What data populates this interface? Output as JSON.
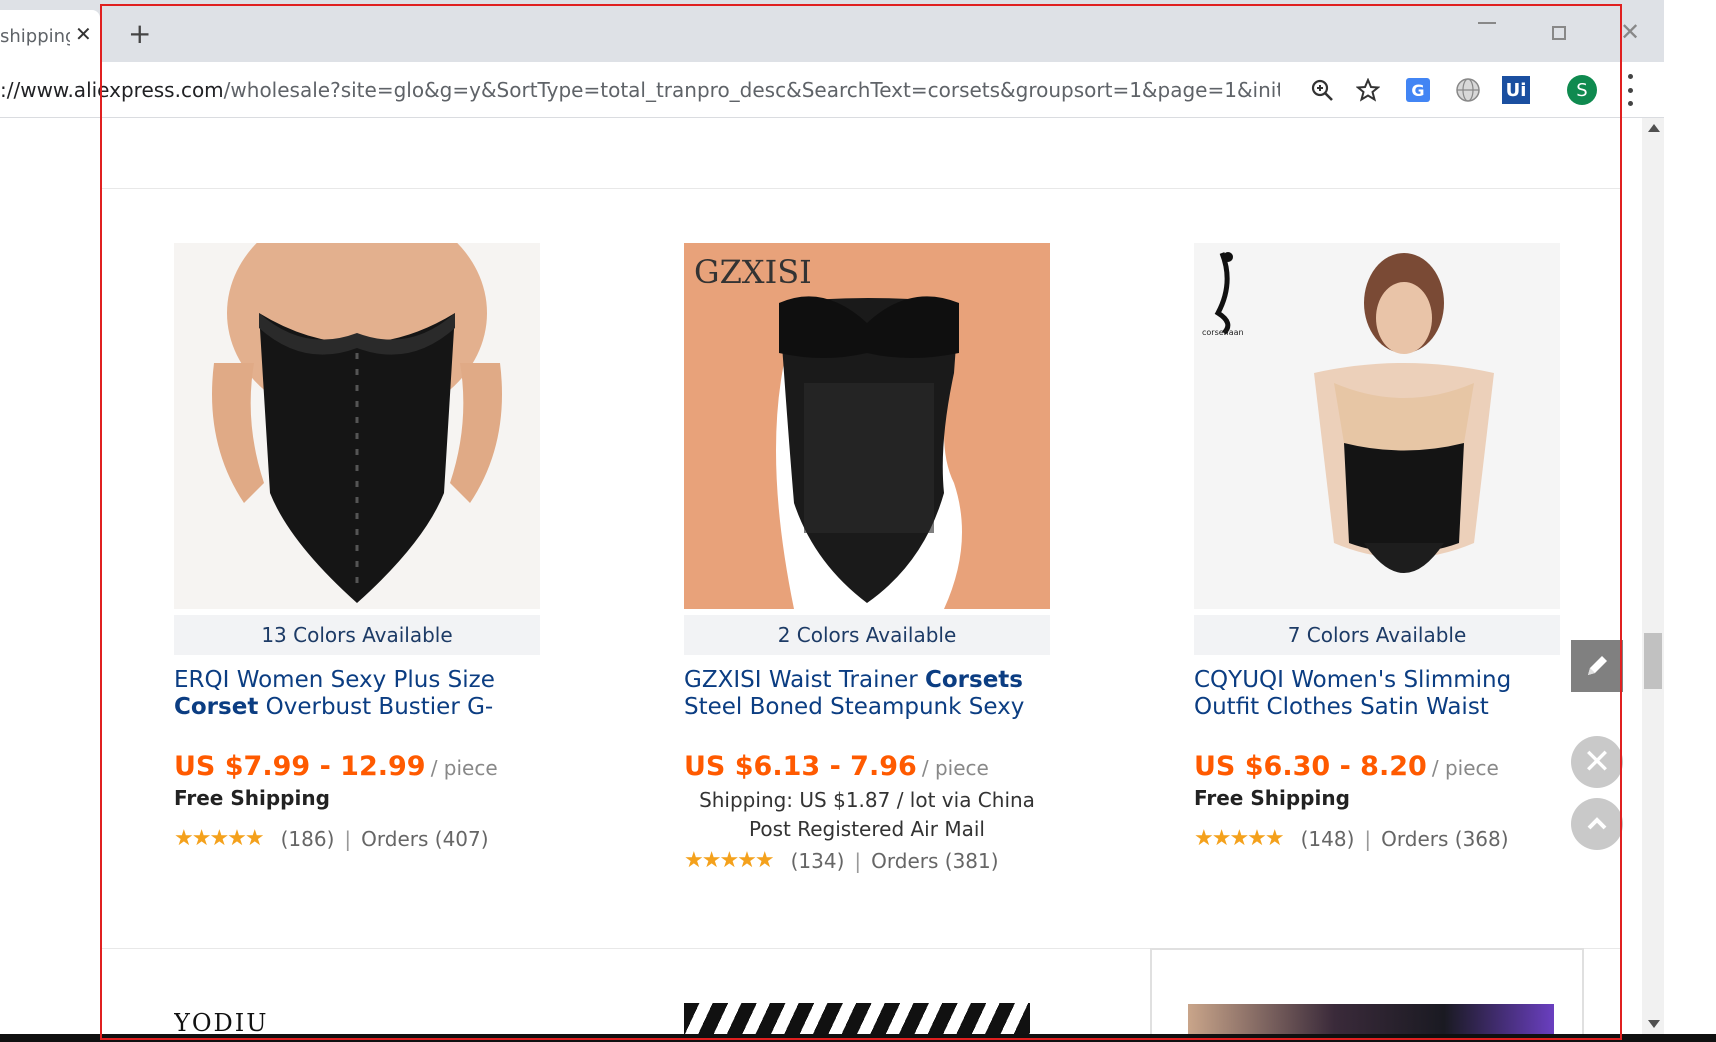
{
  "browser": {
    "tab_title": "shipping",
    "tab_close": "✕",
    "new_tab": "+",
    "url_host": "://www.aliexpress.com",
    "url_path": "/wholesale?site=glo&g=y&SortType=total_tranpro_desc&SearchText=corsets&groupsort=1&page=1&initiative_i...",
    "avatar_letter": "S",
    "translate_ext": "G",
    "ui_ext": "Ui"
  },
  "products": [
    {
      "colors": "13 Colors Available",
      "title_pre": "ERQI Women Sexy Plus Size ",
      "title_bold": "Corset",
      "title_post": " Overbust Bustier G-String",
      "price": "US $7.99 - 12.99",
      "unit": "/ piece",
      "shipping": "Free Shipping",
      "stars": "★★★★★",
      "reviews": "(186)",
      "separator": "|",
      "orders": "Orders (407)"
    },
    {
      "colors": "2 Colors Available",
      "title_pre": "GZXISI Waist Trainer ",
      "title_bold": "Corsets",
      "title_post": " Steel Boned Steampunk Sexy Intimates",
      "price": "US $6.13 - 7.96",
      "unit": "/ piece",
      "shipping": "Shipping: US $1.87 / lot via China Post Registered Air Mail",
      "stars": "★★★★★",
      "reviews": "(134)",
      "separator": "|",
      "orders": "Orders (381)",
      "image_watermark": "GZXISI"
    },
    {
      "colors": "7 Colors Available",
      "title_pre": "CQYUQI Women's Slimming Outfit Clothes Satin Waist Cincher",
      "title_bold": "",
      "title_post": "",
      "price": "US $6.30 - 8.20",
      "unit": "/ piece",
      "shipping": "Free Shipping",
      "stars": "★★★★★",
      "reviews": "(148)",
      "separator": "|",
      "orders": "Orders (368)",
      "image_logo_text": "corsenaan"
    }
  ],
  "next_row": {
    "brand": "YODIU"
  },
  "float": {
    "close": "✕"
  },
  "colors": {
    "price": "#ff5a00",
    "title_link": "#0b3d82",
    "star": "#f4a11c",
    "selection": "#e02020"
  },
  "icons": [
    "search-icon",
    "star-bookmark-icon",
    "translate-icon",
    "globe-icon",
    "ui-extension-icon",
    "avatar",
    "menu-icon",
    "edit-icon",
    "close-icon",
    "scroll-top-icon"
  ]
}
